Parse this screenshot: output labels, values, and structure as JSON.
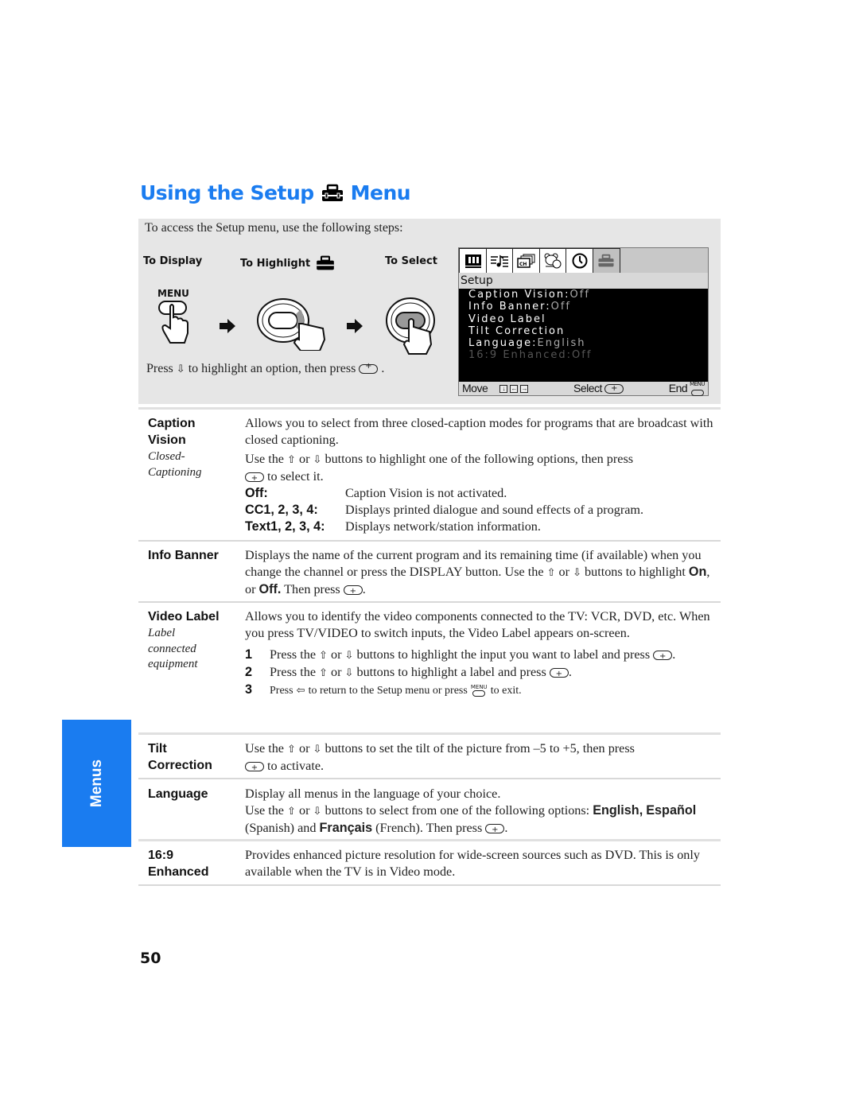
{
  "title": {
    "before": "Using the Setup",
    "after": "Menu",
    "icon": "toolbox-icon"
  },
  "intro": "To access the Setup menu, use the following steps:",
  "steps": {
    "to_display": "To Display",
    "to_highlight": "To Highlight",
    "to_select": "To Select",
    "menu_label": "MENU",
    "press_line_a": "Press",
    "press_line_b": "to highlight an option, then press",
    "press_line_c": "."
  },
  "osd": {
    "icons": [
      "picture-icon",
      "sound-icon",
      "channel-icon",
      "parent-icon",
      "timer-icon",
      "setup-icon"
    ],
    "title": "Setup",
    "items": [
      {
        "label": "Caption Vision:",
        "value": "Off"
      },
      {
        "label": " Info Banner:",
        "value": "Off"
      },
      {
        "label": "Video Label",
        "value": ""
      },
      {
        "label": "Tilt Correction",
        "value": ""
      },
      {
        "label": "Language:",
        "value": "English"
      },
      {
        "label": "16:9 Enhanced:",
        "value": "Off"
      }
    ],
    "footer": {
      "move": "Move",
      "select": "Select",
      "end": "End",
      "menu_small": "MENU"
    }
  },
  "sections": {
    "caption": {
      "term": [
        "Caption",
        "Vision"
      ],
      "subterm": [
        "Closed-",
        "Captioning"
      ],
      "desc1": "Allows you to select from three closed-caption modes for programs that are broadcast with closed captioning.",
      "desc2a": "Use the",
      "desc2b": "or",
      "desc2c": "buttons to highlight one of the following options, then press",
      "desc2d": "to select it.",
      "options": [
        {
          "key": "Off:",
          "text": "Caption Vision is not activated."
        },
        {
          "key": "CC1, 2, 3, 4:",
          "text": "Displays printed dialogue and sound effects of a program."
        },
        {
          "key": "Text1, 2, 3, 4:",
          "text": "Displays network/station information."
        }
      ]
    },
    "info": {
      "term": "Info Banner",
      "desc_a": "Displays the name of the current program and its remaining time (if available) when you change the channel or press the DISPLAY button. Use the",
      "desc_b": "or",
      "desc_c": "buttons to highlight",
      "on": "On",
      "comma_or": ", or",
      "off": "Off.",
      "then_press": " Then press",
      "period": "."
    },
    "video": {
      "term": "Video Label",
      "subterm": [
        "Label",
        "connected",
        "equipment"
      ],
      "desc": "Allows you to identify the video components connected to the TV: VCR, DVD, etc. When you press TV/VIDEO to switch inputs, the Video Label appears on-screen.",
      "steps": [
        {
          "n": "1",
          "a": "Press the",
          "b": "or",
          "c": "buttons to highlight the input you want to label and press",
          "d": "."
        },
        {
          "n": "2",
          "a": "Press the",
          "b": "or",
          "c": "buttons to highlight a label and press",
          "d": "."
        },
        {
          "n": "3",
          "a": "Press",
          "c": "to return to the Setup menu or press",
          "d": "to exit."
        }
      ]
    },
    "tilt": {
      "term": [
        "Tilt",
        "Correction"
      ],
      "a": "Use the",
      "b": "or",
      "c": "buttons to set the tilt of the picture from –5 to +5, then press",
      "d": "to activate."
    },
    "language": {
      "term": "Language",
      "line1": "Display all menus in the language of your choice.",
      "a": "Use the",
      "b": "or",
      "c": "buttons to select from one of the following options:",
      "english": "English,",
      "espanol": "Español",
      "spanish": " (Spanish) and ",
      "francais": "Français",
      "french": " (French). Then press",
      "period": "."
    },
    "enhanced": {
      "term": [
        "16:9",
        "Enhanced"
      ],
      "desc": "Provides enhanced picture resolution for wide-screen sources such as DVD. This is only available when the TV is in Video mode."
    }
  },
  "side_tab": "Menus",
  "page_number": "50",
  "glyphs": {
    "up": "⇧",
    "down": "⇩",
    "left": "⇦"
  },
  "colors": {
    "accent": "#1a7cf0"
  }
}
